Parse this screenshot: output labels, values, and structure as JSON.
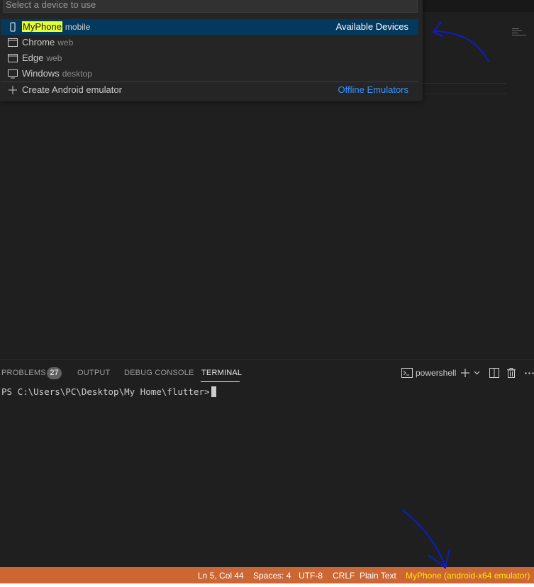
{
  "quickpick": {
    "placeholder": "Select a device to use",
    "items": [
      {
        "icon": "phone-icon",
        "label": "MyPhone",
        "description": "mobile",
        "right": "Available Devices"
      },
      {
        "icon": "window-icon",
        "label": "Chrome",
        "description": "web"
      },
      {
        "icon": "window-icon",
        "label": "Edge",
        "description": "web"
      },
      {
        "icon": "monitor-icon",
        "label": "Windows",
        "description": "desktop"
      },
      {
        "icon": "plus-icon",
        "label": "Create Android emulator",
        "right": "Offline Emulators"
      }
    ]
  },
  "panel": {
    "tabs": [
      {
        "label": "PROBLEMS",
        "badge": "27"
      },
      {
        "label": "OUTPUT"
      },
      {
        "label": "DEBUG CONSOLE"
      },
      {
        "label": "TERMINAL",
        "active": true
      }
    ],
    "terminal_name": "powershell",
    "terminal_prompt": "PS C:\\Users\\PC\\Desktop\\My Home\\flutter>"
  },
  "statusbar": {
    "position": "Ln 5, Col 44",
    "spaces": "Spaces: 4",
    "encoding": "UTF-8",
    "eol": "CRLF",
    "language": "Plain Text",
    "device": "MyPhone (android-x64 emulator)"
  },
  "colors": {
    "statusbar_bg": "#cc6633",
    "selection_bg": "#04395e",
    "highlight": "#e7ff2e",
    "link": "#3794ff",
    "annotation": "#0a1fc8"
  }
}
